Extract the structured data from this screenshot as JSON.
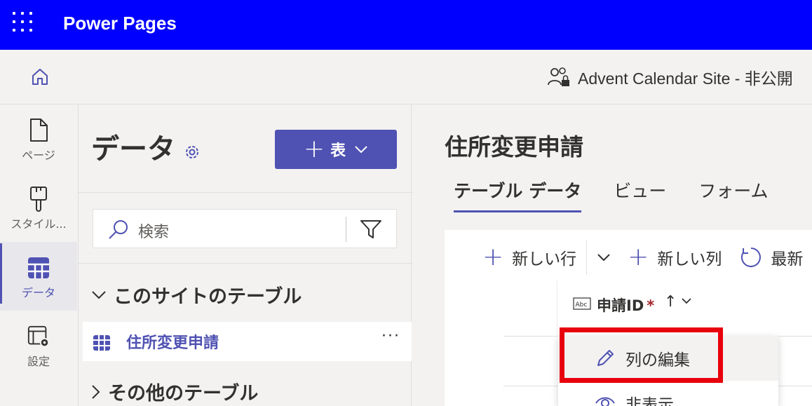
{
  "app": {
    "title": "Power Pages"
  },
  "subbar": {
    "site_name": "Advent Calendar Site - 非公開"
  },
  "leftnav": [
    {
      "label": "ページ",
      "icon": "page-icon"
    },
    {
      "label": "スタイル...",
      "icon": "brush-icon"
    },
    {
      "label": "データ",
      "icon": "data-table-icon",
      "active": true
    },
    {
      "label": "設定",
      "icon": "settings-icon"
    }
  ],
  "panel": {
    "title": "データ",
    "table_button": "表",
    "search_placeholder": "検索",
    "section_this_site": "このサイトのテーブル",
    "selected_table": "住所変更申請",
    "section_other": "その他のテーブル"
  },
  "main": {
    "title": "住所変更申請",
    "tabs": [
      "テーブル データ",
      "ビュー",
      "フォーム"
    ],
    "commands": {
      "new_row": "新しい行",
      "new_column": "新しい列",
      "refresh": "最新"
    },
    "column": {
      "name": "申請ID",
      "required_marker": "*",
      "sort_arrow": "↑"
    }
  },
  "context_menu": {
    "edit_column": "列の編集",
    "hide": "非表示"
  },
  "colors": {
    "topbar": "#0000ff",
    "accent": "#4f52b2",
    "highlight": "#e8000d"
  }
}
